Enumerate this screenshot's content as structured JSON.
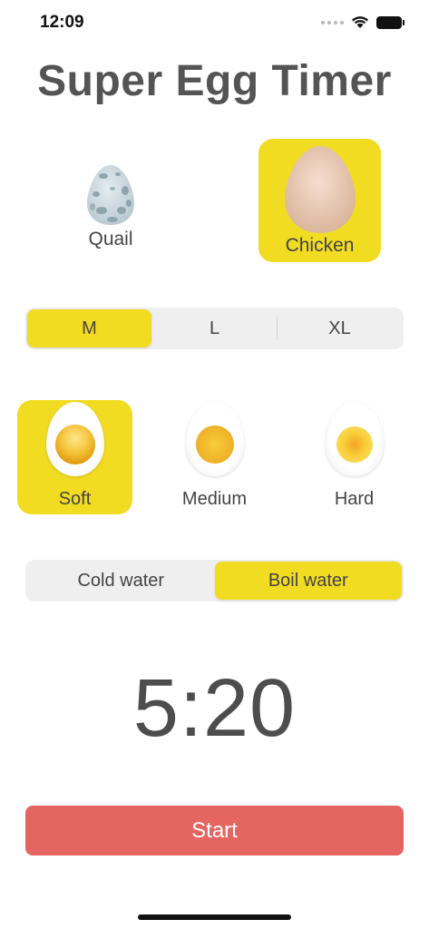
{
  "status_bar": {
    "time": "12:09"
  },
  "title": "Super Egg Timer",
  "egg_types": [
    {
      "label": "Quail",
      "selected": false
    },
    {
      "label": "Chicken",
      "selected": true
    }
  ],
  "size_options": [
    {
      "label": "M",
      "selected": true
    },
    {
      "label": "L",
      "selected": false
    },
    {
      "label": "XL",
      "selected": false
    }
  ],
  "doneness": [
    {
      "label": "Soft",
      "selected": true
    },
    {
      "label": "Medium",
      "selected": false
    },
    {
      "label": "Hard",
      "selected": false
    }
  ],
  "water_options": [
    {
      "label": "Cold water",
      "selected": false
    },
    {
      "label": "Boil water",
      "selected": true
    }
  ],
  "timer": "5:20",
  "start_label": "Start",
  "colors": {
    "accent": "#f2dc22",
    "start_button": "#e56561",
    "segment_bg": "#efefef"
  },
  "icons": {
    "quail": "quail-egg-icon",
    "chicken": "chicken-egg-icon",
    "soft": "soft-boiled-egg-icon",
    "medium": "medium-boiled-egg-icon",
    "hard": "hard-boiled-egg-icon"
  }
}
